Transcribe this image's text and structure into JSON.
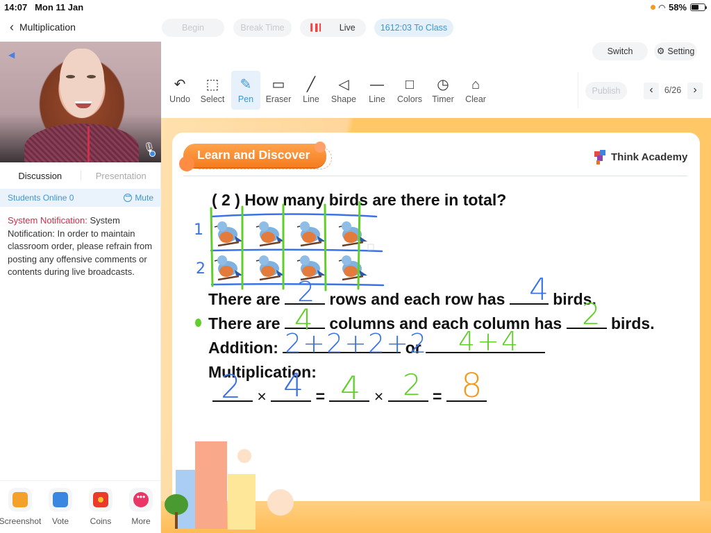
{
  "status_bar": {
    "time": "14:07",
    "date": "Mon 11 Jan",
    "battery": "58%"
  },
  "header": {
    "back_label": "Multiplication",
    "pills": {
      "begin": "Begin",
      "break_time": "Break Time",
      "live": "Live",
      "to_class": "1612:03 To Class"
    },
    "switch": "Switch",
    "setting": "Setting"
  },
  "sidebar": {
    "tabs": [
      {
        "label": "Discussion",
        "active": true
      },
      {
        "label": "Presentation",
        "active": false
      }
    ],
    "students_online": "Students Online 0",
    "mute": "Mute",
    "notice_label": "System Notification:",
    "notice_text": " System Notification: In order to maintain classroom order, please refrain from posting any offensive comments or contents during live broadcasts.",
    "bottom_tools": [
      {
        "label": "Screenshot",
        "icon": "scissors-icon"
      },
      {
        "label": "Vote",
        "icon": "vote-icon"
      },
      {
        "label": "Coins",
        "icon": "coins-icon"
      },
      {
        "label": "More",
        "icon": "more-icon"
      }
    ]
  },
  "toolbar": {
    "tools": [
      {
        "label": "Undo",
        "icon": "undo-icon",
        "glyph": "↶"
      },
      {
        "label": "Select",
        "icon": "select-icon",
        "glyph": "⬚"
      },
      {
        "label": "Pen",
        "icon": "pen-icon",
        "glyph": "✎",
        "active": true
      },
      {
        "label": "Eraser",
        "icon": "eraser-icon",
        "glyph": "▭"
      },
      {
        "label": "Line",
        "icon": "line-icon",
        "glyph": "╱"
      },
      {
        "label": "Shape",
        "icon": "shape-icon",
        "glyph": "◁"
      },
      {
        "label": "Line",
        "icon": "line-weight-icon",
        "glyph": "—"
      },
      {
        "label": "Colors",
        "icon": "colors-icon",
        "glyph": "□"
      },
      {
        "label": "Timer",
        "icon": "timer-icon",
        "glyph": "◷"
      },
      {
        "label": "Clear",
        "icon": "clear-icon",
        "glyph": "⌂"
      }
    ],
    "publish": "Publish",
    "page": "6/26"
  },
  "slide": {
    "banner": "Learn and Discover",
    "brand": "Think Academy",
    "question": "( 2 ) How many birds are there in total?",
    "line1": {
      "a": "There are",
      "b": "rows and each row has",
      "c": "birds.",
      "ans1": "2",
      "ans2": "4"
    },
    "line2": {
      "a": "There are",
      "b": "columns and each column has",
      "c": "birds.",
      "ans1": "4",
      "ans2": "2"
    },
    "line3": {
      "a": "Addition:",
      "b": "or",
      "ans1": "2+2+2+2",
      "ans2": "4+4"
    },
    "line4": {
      "a": "Multiplication:",
      "times": "×",
      "equals": "=",
      "ans": [
        "2",
        "4",
        "4",
        "2",
        "8"
      ]
    },
    "row_labels": [
      "1",
      "2"
    ],
    "ink_colors": {
      "blue": "#3a73e6",
      "green": "#5fcf2a",
      "orange": "#f39a1c"
    }
  }
}
